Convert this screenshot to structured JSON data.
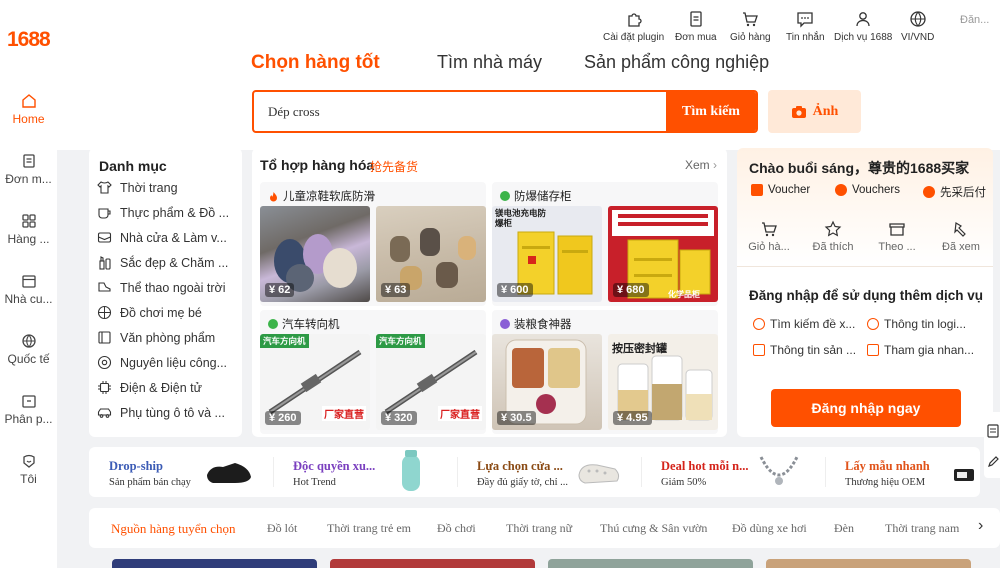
{
  "logo": "1688",
  "sidebar": {
    "items": [
      {
        "label": "Home",
        "icon": "home-icon"
      },
      {
        "label": "Đơn m...",
        "icon": "clipboard-icon"
      },
      {
        "label": "Hàng ...",
        "icon": "grid-icon"
      },
      {
        "label": "Nhà cu...",
        "icon": "calendar-icon"
      },
      {
        "label": "Quốc tế",
        "icon": "globe-icon"
      },
      {
        "label": "Phân p...",
        "icon": "folder-icon"
      },
      {
        "label": "Tôi",
        "icon": "user-icon"
      }
    ]
  },
  "topnav": {
    "items": [
      {
        "label": "Cài đặt plugin",
        "icon": "puzzle-icon"
      },
      {
        "label": "Đơn mua",
        "icon": "document-icon"
      },
      {
        "label": "Giỏ hàng",
        "icon": "cart-icon"
      },
      {
        "label": "Tin nhắn",
        "icon": "chat-icon"
      },
      {
        "label": "Dịch vụ 1688",
        "icon": "person-icon"
      },
      {
        "label": "VI/VND",
        "icon": "globe-icon"
      }
    ],
    "account": "Đăn..."
  },
  "tabs": [
    "Chọn hàng tốt",
    "Tìm nhà máy",
    "Sản phẩm công nghiệp"
  ],
  "search": {
    "value": "Dép cross",
    "button": "Tìm kiếm",
    "image_button": "Ảnh"
  },
  "categories": {
    "title": "Danh mục",
    "items": [
      "Thời trang",
      "Thực phẩm & Đồ ...",
      "Nhà cửa & Làm v...",
      "Sắc đẹp & Chăm ...",
      "Thể thao ngoài trời",
      "Đồ chơi mẹ bé",
      "Văn phòng phẩm",
      "Nguyên liệu công...",
      "Điện & Điện tử",
      "Phụ tùng ô tô và ..."
    ]
  },
  "combo": {
    "title": "Tổ hợp hàng hóa",
    "subtitle": "抢先备货",
    "more": "Xem",
    "groups": [
      {
        "name": "儿童凉鞋软底防滑",
        "products": [
          {
            "price": "¥ 62"
          },
          {
            "price": "¥ 63"
          }
        ]
      },
      {
        "name": "防爆储存柜",
        "products": [
          {
            "price": "¥ 600",
            "text": "镁电池充电防爆柜"
          },
          {
            "price": "¥ 680",
            "text": "化学品柜"
          }
        ]
      },
      {
        "name": "汽车转向机",
        "products": [
          {
            "price": "¥ 260",
            "text": "汽车方向机",
            "badge": "厂家直营"
          },
          {
            "price": "¥ 320",
            "text": "汽车方向机",
            "badge": "厂家直营"
          }
        ]
      },
      {
        "name": "装粮食神器",
        "products": [
          {
            "price": "¥ 30.5"
          },
          {
            "price": "¥ 4.95",
            "text": "按压密封罐"
          }
        ]
      }
    ]
  },
  "user_panel": {
    "greeting": "Chào buổi sáng，尊贵的1688买家",
    "perks": [
      "Voucher",
      "Vouchers",
      "先采后付"
    ],
    "quick": [
      {
        "label": "Giỏ hà...",
        "icon": "cart-icon"
      },
      {
        "label": "Đã thích",
        "icon": "star-icon"
      },
      {
        "label": "Theo ...",
        "icon": "shop-icon"
      },
      {
        "label": "Đã xem",
        "icon": "history-icon"
      }
    ],
    "login_title": "Đăng nhập để sử dụng thêm dịch vụ",
    "services": [
      "Tìm kiếm đề x...",
      "Thông tin logi...",
      "Thông tin sản ...",
      "Tham gia nhan..."
    ],
    "login_button": "Đăng nhập ngay"
  },
  "promos": [
    {
      "title": "Drop-ship",
      "subtitle": "Sản phẩm bán chạy",
      "color": "#3b5bb5"
    },
    {
      "title": "Độc quyền xu...",
      "subtitle": "Hot Trend",
      "color": "#7a3fbf"
    },
    {
      "title": "Lựa chọn cửa ...",
      "subtitle": "Đầy đủ giấy tờ, chỉ ...",
      "color": "#8a4a14"
    },
    {
      "title": "Deal hot mỗi n...",
      "subtitle": "Giảm 50%",
      "color": "#d4231a"
    },
    {
      "title": "Lấy mẫu nhanh",
      "subtitle": "Thương hiệu OEM",
      "color": "#e0531a"
    }
  ],
  "category_bar": [
    "Nguồn hàng tuyển chọn",
    "Đồ lót",
    "Thời trang trẻ em",
    "Đồ chơi",
    "Thời trang nữ",
    "Thú cưng & Sân vườn",
    "Đồ dùng xe hơi",
    "Đèn",
    "Thời trang nam"
  ],
  "colors": {
    "accent": "#ff5000",
    "accent_light": "#ffe9d8",
    "bg": "#f1f2f4"
  }
}
